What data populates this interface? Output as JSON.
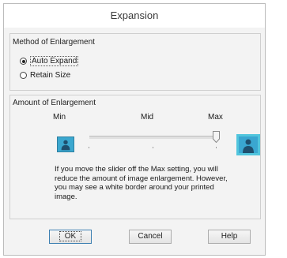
{
  "dialog": {
    "title": "Expansion"
  },
  "method": {
    "group_title": "Method of Enlargement",
    "options": [
      {
        "label": "Auto Expand",
        "selected": true
      },
      {
        "label": "Retain Size",
        "selected": false
      }
    ]
  },
  "amount": {
    "group_title": "Amount of Enlargement",
    "labels": {
      "min": "Min",
      "mid": "Mid",
      "max": "Max"
    },
    "slider_level": "Max",
    "info_text": "If you move the slider off the Max setting, you will reduce the amount of image enlargement. However, you may see a white border around your printed image.",
    "icons": {
      "small": "person-image-icon",
      "large": "person-image-large-icon"
    },
    "colors": {
      "image": "#3ba7cf",
      "frame": "#51c5dd"
    }
  },
  "buttons": {
    "ok": "OK",
    "cancel": "Cancel",
    "help": "Help"
  }
}
